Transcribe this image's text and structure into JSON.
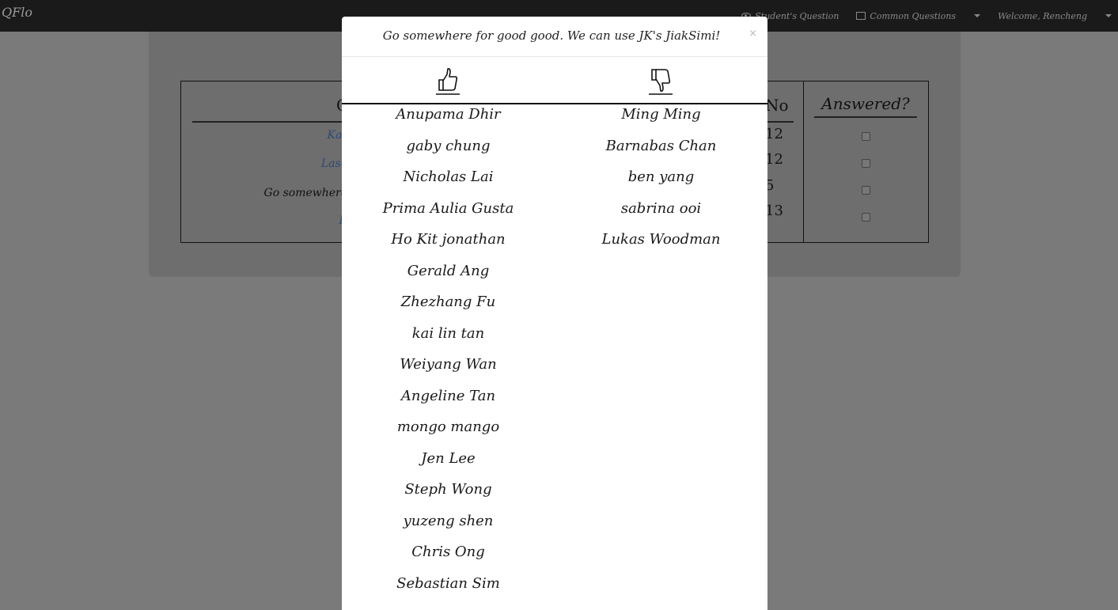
{
  "navbar": {
    "brand": "QFlo",
    "items": [
      {
        "label": "Student's Question",
        "icon": "eye-icon"
      },
      {
        "label": "Common Questions",
        "icon": "list-icon"
      },
      {
        "label": "Welcome, Rencheng",
        "icon": ""
      }
    ]
  },
  "background_table": {
    "headers": {
      "answered": "Answered?"
    },
    "rows": [
      {
        "question": "Kar",
        "no": "12"
      },
      {
        "question": "Lase",
        "no": "12"
      },
      {
        "question": "Go somewhere for good",
        "no": "5"
      },
      {
        "question": "R",
        "no": "13"
      }
    ]
  },
  "modal": {
    "title": "Go somewhere for good good. We can use JK's JiakSimi!",
    "close": "×",
    "upvoters": [
      "Anupama Dhir",
      "gaby chung",
      "Nicholas Lai",
      "Prima Aulia Gusta",
      "Ho Kit jonathan",
      "Gerald Ang",
      "Zhezhang Fu",
      "kai lin tan",
      "Weiyang Wan",
      "Angeline Tan",
      "mongo mango",
      "Jen Lee",
      "Steph Wong",
      "yuzeng shen",
      "Chris Ong",
      "Sebastian Sim"
    ],
    "downvoters": [
      "Ming Ming",
      "Barnabas Chan",
      "ben yang",
      "sabrina ooi",
      "Lukas Woodman"
    ]
  }
}
